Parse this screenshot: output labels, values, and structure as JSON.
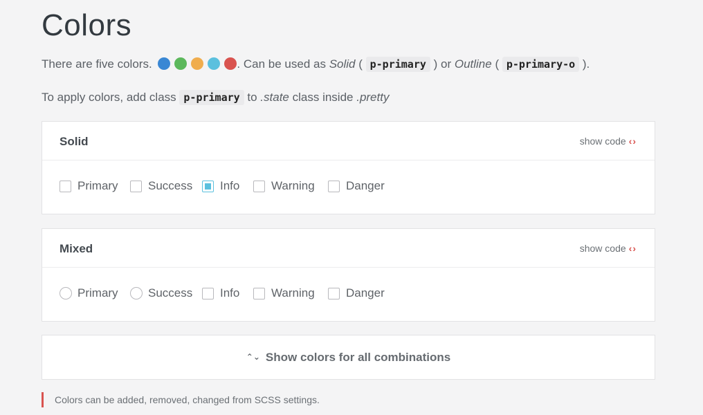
{
  "page": {
    "title": "Colors",
    "intro_start": "There are five colors.",
    "intro_mid": ". Can be used as ",
    "solid_word": "Solid",
    "paren_open": " ( ",
    "code_primary": "p-primary",
    "paren_close_or": " ) or ",
    "outline_word": "Outline",
    "code_primary_o": "p-primary-o",
    "paren_close_end": " ).",
    "apply_start": "To apply colors, add class ",
    "apply_code": "p-primary",
    "apply_to": " to ",
    "state_word": ".state",
    "apply_inside": " class inside ",
    "pretty_word": ".pretty"
  },
  "colors": [
    "#3a87d4",
    "#5cb85c",
    "#f0ad4e",
    "#5bc0de",
    "#d9534f"
  ],
  "solid_card": {
    "title": "Solid",
    "show_code": "show code",
    "options": [
      "Primary",
      "Success",
      "Info",
      "Warning",
      "Danger"
    ],
    "checked": [
      false,
      false,
      true,
      false,
      false
    ]
  },
  "mixed_card": {
    "title": "Mixed",
    "show_code": "show code",
    "options": [
      "Primary",
      "Success",
      "Info",
      "Warning",
      "Danger"
    ]
  },
  "toggle": {
    "label": "Show colors for all combinations"
  },
  "note": "Colors can be added, removed, changed from SCSS settings."
}
